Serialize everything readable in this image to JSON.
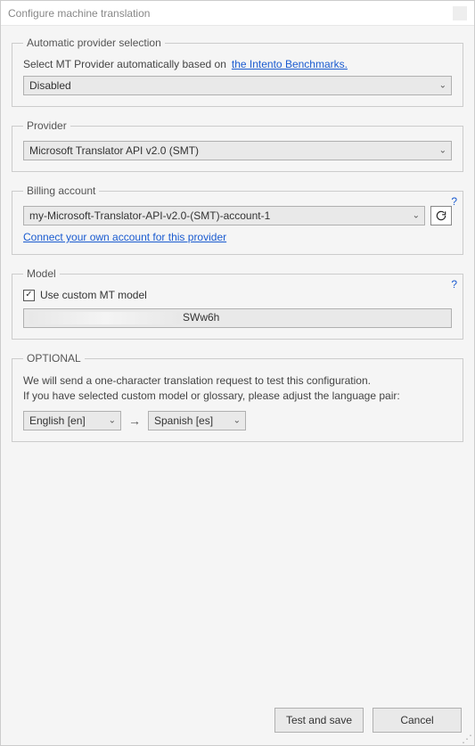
{
  "window": {
    "title": "Configure machine translation"
  },
  "auto_provider": {
    "legend": "Automatic provider selection",
    "label": "Select MT Provider automatically based on",
    "link": "the Intento Benchmarks.",
    "select_value": "Disabled"
  },
  "provider": {
    "legend": "Provider",
    "select_value": "Microsoft Translator API v2.0 (SMT)"
  },
  "billing": {
    "legend": "Billing account",
    "help": "?",
    "select_value": "my-Microsoft-Translator-API-v2.0-(SMT)-account-1",
    "connect_link": "Connect your own account for this provider"
  },
  "model": {
    "legend": "Model",
    "help": "?",
    "checkbox_label": "Use custom MT model",
    "checkbox_checked": true,
    "input_suffix": "SWw6h"
  },
  "optional": {
    "legend": "OPTIONAL",
    "line1": "We will send a one-character translation request to test this configuration.",
    "line2": "If you have selected custom model or glossary, please adjust the language pair:",
    "lang_from": "English [en]",
    "lang_to": "Spanish [es]"
  },
  "footer": {
    "test_save": "Test and save",
    "cancel": "Cancel"
  }
}
